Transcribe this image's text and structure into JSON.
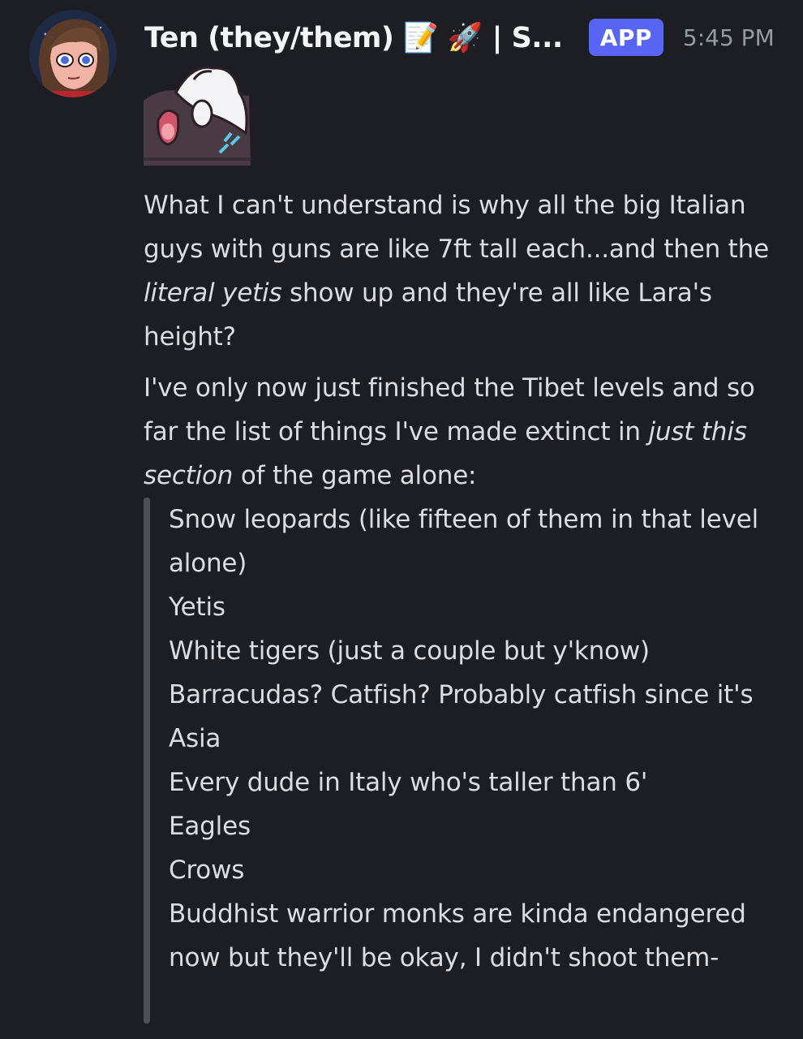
{
  "message": {
    "author": {
      "name": "Ten (they/them) 📝 🚀 | S...",
      "badge": "APP",
      "timestamp": "5:45 PM",
      "avatar_icon": "avatar-illustrated-person-icon"
    },
    "sticker": {
      "icon": "sticker-creature-icon"
    },
    "paragraph1": {
      "before": "What I can't understand is why all the big Italian guys with guns are like 7ft tall each...and then the ",
      "italic": "literal yetis",
      "after": " show up and they're all like Lara's height?"
    },
    "paragraph2": {
      "before": "I've only now just finished the Tibet levels and so far the list of things I've made extinct in ",
      "italic": "just this section",
      "after": " of the game alone:"
    },
    "quote_lines": [
      "Snow leopards (like fifteen of them in that level alone)",
      "Yetis",
      "White tigers (just a couple but y'know)",
      "Barracudas? Catfish? Probably catfish since it's Asia",
      "Every dude in Italy who's taller than 6'",
      "Eagles",
      "Crows",
      "Buddhist warrior monks are kinda endangered now but they'll be okay, I didn't shoot them-"
    ]
  },
  "colors": {
    "background": "#1d1e23",
    "text": "#dcdde2",
    "username": "#f2f3f5",
    "badge": "#5865f2",
    "timestamp": "#949ba4",
    "quote_bar": "#4e5058"
  }
}
